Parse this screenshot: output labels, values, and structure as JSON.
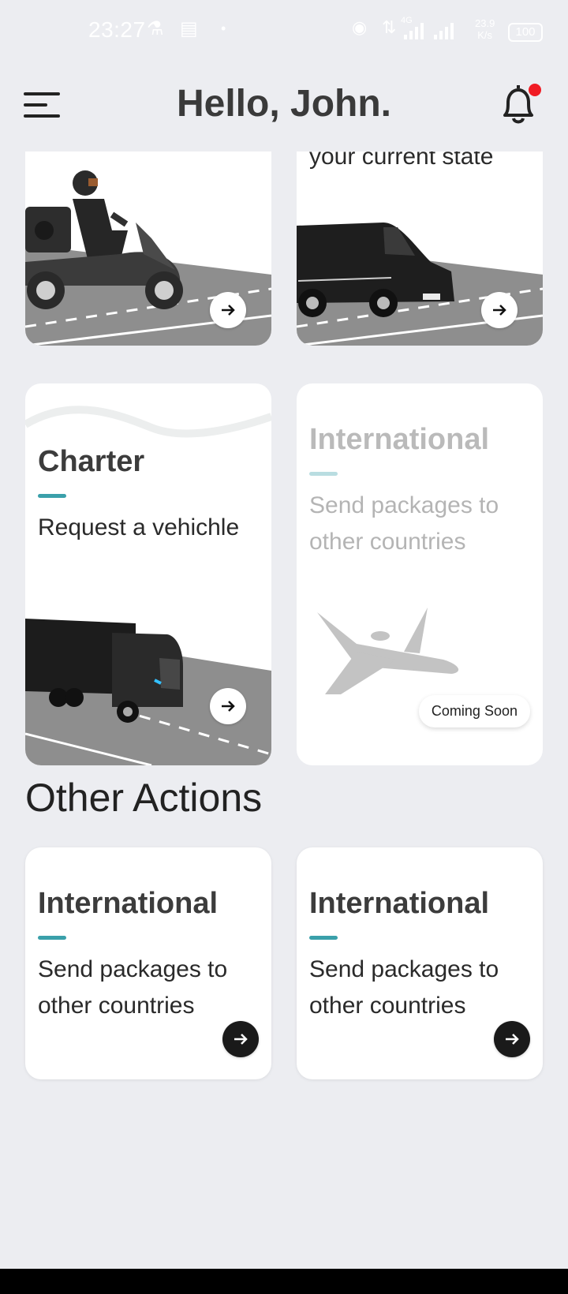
{
  "status_bar": {
    "time": "23:27",
    "network_type": "4G",
    "speed_value": "23.9",
    "speed_unit": "K/s",
    "battery": "100"
  },
  "header": {
    "title": "Hello, John.",
    "menu_icon": "hamburger-menu-icon",
    "bell_icon": "bell-icon",
    "notification_color": "#f01c24"
  },
  "services": [
    {
      "id": "bike",
      "title": "",
      "subtitle": "",
      "image": "scooter-courier"
    },
    {
      "id": "van",
      "title": "",
      "subtitle": "your current state",
      "image": "delivery-van"
    },
    {
      "id": "charter",
      "title": "Charter",
      "subtitle": "Request a vehichle",
      "image": "truck"
    },
    {
      "id": "international",
      "title": "International",
      "subtitle_line1": "Send packages to",
      "subtitle_line2": "other countries",
      "badge": "Coming Soon",
      "image": "private-jet",
      "disabled": true
    }
  ],
  "other_actions": {
    "title": "Other Actions",
    "items": [
      {
        "title": "International",
        "subtitle_line1": "Send packages to",
        "subtitle_line2": "other countries"
      },
      {
        "title": "International",
        "subtitle_line1": "Send packages to",
        "subtitle_line2": "other countries"
      }
    ]
  },
  "colors": {
    "background": "#ecedf1",
    "accent": "#3aa0aa",
    "road": "#8a8a8a",
    "card": "#ffffff"
  }
}
